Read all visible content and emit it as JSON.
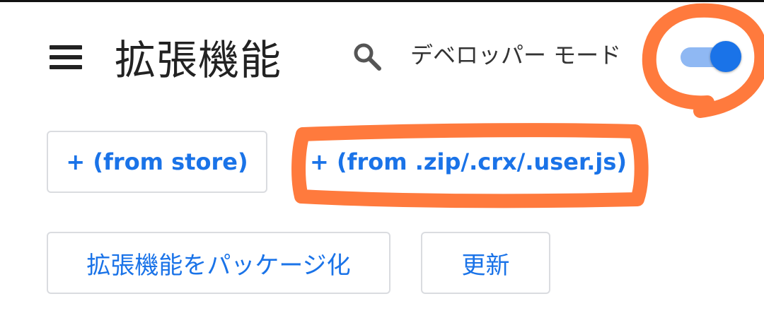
{
  "header": {
    "title": "拡張機能",
    "menu_icon": "hamburger-menu-icon",
    "search_icon": "search-icon"
  },
  "developer_mode": {
    "label": "デベロッパー モード",
    "enabled": true,
    "track_color": "#8fb8f3",
    "knob_color": "#1a73e8"
  },
  "actions": {
    "from_store_label": "+ (from store)",
    "from_file_label": "+ (from .zip/.crx/.user.js)",
    "pack_label": "拡張機能をパッケージ化",
    "update_label": "更新"
  },
  "colors": {
    "accent": "#1a73e8",
    "annotation": "#ff7a3d",
    "border": "#dadce0",
    "text": "#222222"
  }
}
